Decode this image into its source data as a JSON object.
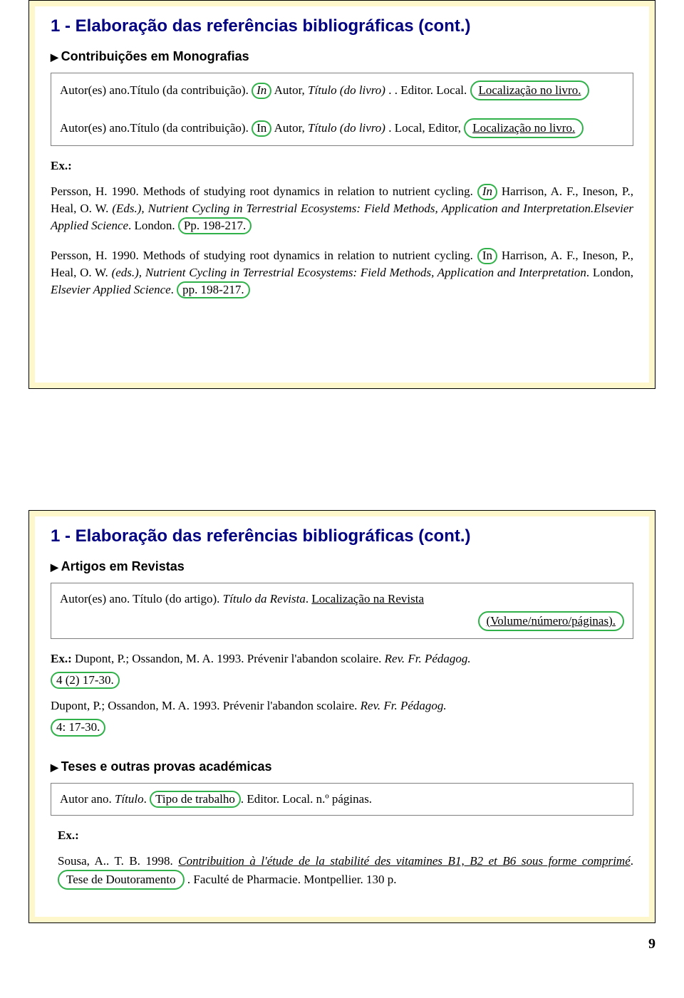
{
  "slide1": {
    "title": "1 - Elaboração das referências bibliográficas (cont.)",
    "sub1": "Contribuições em Monografias",
    "boxA_pre": "Autor(es) ano.Título (da contribuição). ",
    "boxA_in": "In",
    "boxA_mid": " Autor, ",
    "boxA_titulo": "Título (do livro)",
    "boxA_post": ". . Editor. Local. ",
    "boxA_loc": "Localização no livro.",
    "boxB_pre": "Autor(es) ano.Título (da contribuição). ",
    "boxB_in": "In",
    "boxB_mid": " Autor, ",
    "boxB_titulo": "Título (do livro)",
    "boxB_post": ". Local, Editor, ",
    "boxB_loc": "Localização no livro.",
    "ex_label": "Ex.:",
    "p1_a": "Persson, H. 1990. Methods of studying root dynamics in relation to nutrient cycling. ",
    "p1_in": "In",
    "p1_b": " Harrison, A. F., Ineson, P., Heal, O. W. ",
    "p1_eds": "(Eds.), Nutrient Cycling in Terrestrial Ecosystems: Field Methods, Application and Interpretation.Elsevier Applied Science",
    "p1_c": ". London. ",
    "p1_pp": "Pp. 198-217.",
    "p2_a": "Persson, H. 1990. Methods of studying root dynamics in relation to nutrient cycling. ",
    "p2_in": "In",
    "p2_b": " Harrison, A. F., Ineson, P., Heal, O. W. ",
    "p2_eds": "(eds.), Nutrient Cycling in Terrestrial Ecosystems: Field Methods, Application and Interpretation",
    "p2_after": ". London, ",
    "p2_pub": "Elsevier Applied Science",
    "p2_c": ". ",
    "p2_pp": " pp. 198-217."
  },
  "slide2": {
    "title": "1 - Elaboração das referências bibliográficas (cont.)",
    "sub1": "Artigos em Revistas",
    "boxA_pre": "Autor(es) ano. Título (do artigo). ",
    "boxA_titulo": "Título da Revista",
    "boxA_mid": ". ",
    "boxA_loc1": "Localização na Revista",
    "boxA_loc2": "(Volume/número/páginas).",
    "ex_label": "Ex.:",
    "ex1_a": " Dupont, P.; Ossandon, M. A. 1993. Prévenir l'abandon scolaire. ",
    "ex1_rev": "Rev. Fr. Pédagog.",
    "ex1_vol": "4 (2) 17-30.",
    "ex2_a": "Dupont, P.; Ossandon, M. A. 1993. Prévenir l'abandon scolaire. ",
    "ex2_rev": "Rev. Fr. Pédagog.",
    "ex2_vol": "4: 17-30.",
    "sub2": "Teses e outras provas académicas",
    "boxB_pre": "Autor ano. ",
    "boxB_titulo": "Título",
    "boxB_mid": ". ",
    "boxB_tipo": "Tipo de trabalho",
    "boxB_post": ". Editor. Local. n.º páginas.",
    "ex2_label": "Ex.:",
    "p3_a": "Sousa, A.. T. B. 1998. ",
    "p3_title": "Contribuition à l'étude de la stabilité des vitamines B1, B2 et B6 sous forme comprimé",
    "p3_b": ". ",
    "p3_tese": "Tese de Doutoramento",
    "p3_c": " . Faculté de Pharmacie. Montpellier. 130 p."
  },
  "pagenum": "9"
}
